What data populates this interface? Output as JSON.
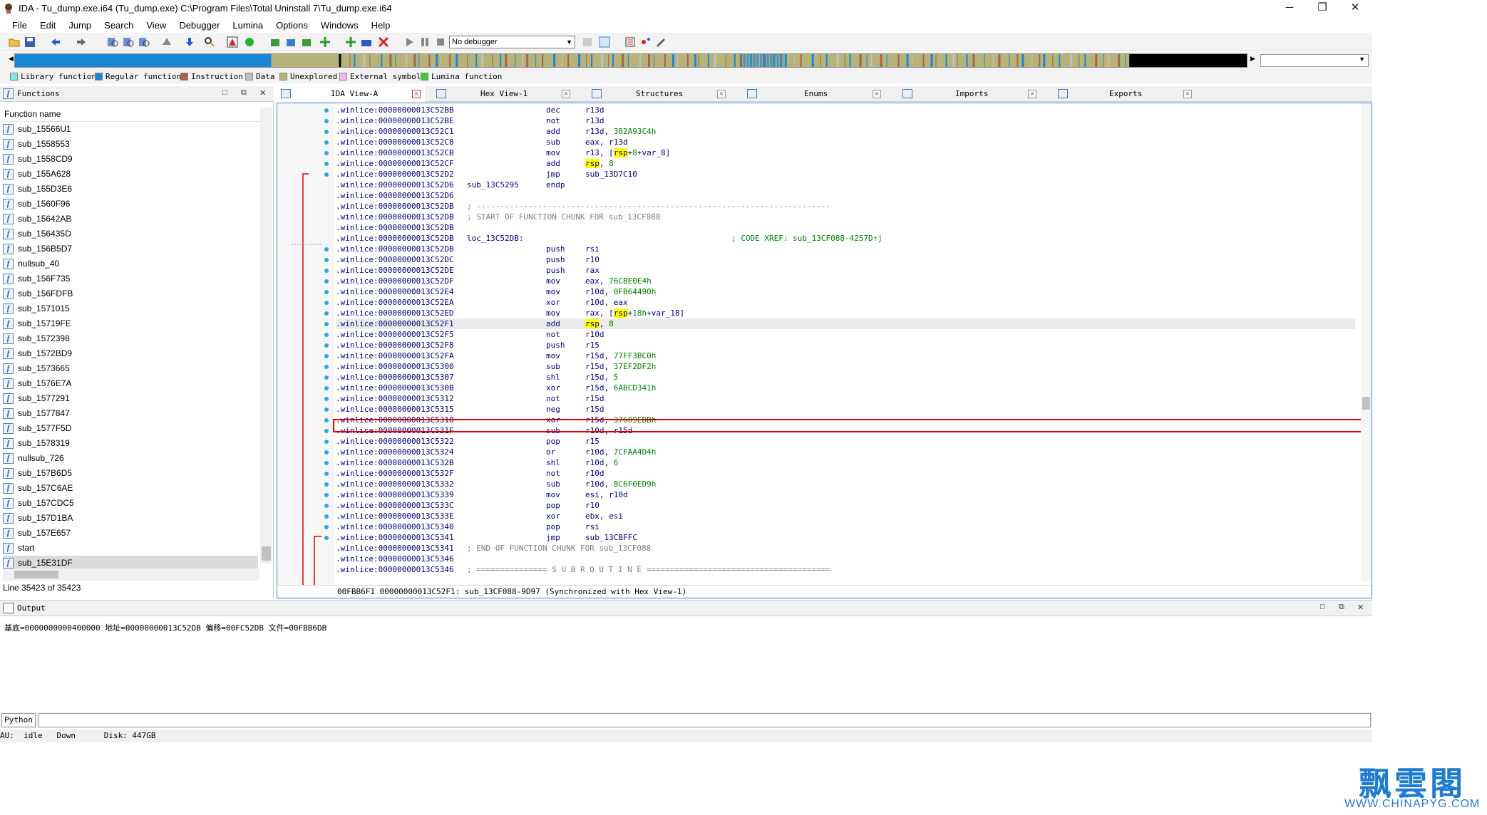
{
  "window": {
    "title": "IDA - Tu_dump.exe.i64 (Tu_dump.exe) C:\\Program Files\\Total Uninstall 7\\Tu_dump.exe.i64",
    "controls": {
      "minimize": "─",
      "restore": "❐",
      "close": "✕"
    }
  },
  "menu": [
    "File",
    "Edit",
    "Jump",
    "Search",
    "View",
    "Debugger",
    "Lumina",
    "Options",
    "Windows",
    "Help"
  ],
  "toolbar": {
    "debugger_select": "No debugger"
  },
  "legend": [
    {
      "label": "Library function",
      "color": "#7fe9ea"
    },
    {
      "label": "Regular function",
      "color": "#1a86d8"
    },
    {
      "label": "Instruction",
      "color": "#a7644b"
    },
    {
      "label": "Data",
      "color": "#c0c0c0"
    },
    {
      "label": "Unexplored",
      "color": "#b7b378"
    },
    {
      "label": "External symbol",
      "color": "#f7b6e6"
    },
    {
      "label": "Lumina function",
      "color": "#3ec93e"
    }
  ],
  "functions_panel": {
    "title": "Functions",
    "column_header": "Function name",
    "items": [
      "sub_15566U1",
      "sub_1558553",
      "sub_1558CD9",
      "sub_155A628",
      "sub_155D3E6",
      "sub_1560F96",
      "sub_15642AB",
      "sub_156435D",
      "sub_156B5D7",
      "nullsub_40",
      "sub_156F735",
      "sub_156FDFB",
      "sub_1571015",
      "sub_15719FE",
      "sub_1572398",
      "sub_1572BD9",
      "sub_1573665",
      "sub_1576E7A",
      "sub_1577291",
      "sub_1577847",
      "sub_1577F5D",
      "sub_1578319",
      "nullsub_726",
      "sub_157B6D5",
      "sub_157C6AE",
      "sub_157CDC5",
      "sub_157D1BA",
      "sub_157E657",
      "start",
      "sub_15E31DF"
    ],
    "selected_index": 29,
    "status": "Line 35423 of 35423"
  },
  "tabs": [
    {
      "label": "IDA View-A",
      "active": true
    },
    {
      "label": "Hex View-1",
      "active": false
    },
    {
      "label": "Structures",
      "active": false
    },
    {
      "label": "Enums",
      "active": false
    },
    {
      "label": "Imports",
      "active": false
    },
    {
      "label": "Exports",
      "active": false
    }
  ],
  "disasm": [
    {
      "addr": ".winlice:00000000013C52BB",
      "mn": "dec",
      "op": "r13d"
    },
    {
      "addr": ".winlice:00000000013C52BE",
      "mn": "not",
      "op": "r13d"
    },
    {
      "addr": ".winlice:00000000013C52C1",
      "mn": "add",
      "op": "r13d, 382A93C4h"
    },
    {
      "addr": ".winlice:00000000013C52C8",
      "mn": "sub",
      "op": "eax, r13d"
    },
    {
      "addr": ".winlice:00000000013C52CB",
      "mn": "mov",
      "op": "r13, [rsp+8+var_8]"
    },
    {
      "addr": ".winlice:00000000013C52CF",
      "mn": "add",
      "op": "rsp, 8"
    },
    {
      "addr": ".winlice:00000000013C52D2",
      "mn": "jmp",
      "op": "sub_13D7C10"
    },
    {
      "addr": ".winlice:00000000013C52D6",
      "raw": "sub_13C5295",
      "mn": "endp",
      "op": ""
    },
    {
      "addr": ".winlice:00000000013C52D6",
      "mn": "",
      "op": ""
    },
    {
      "addr": ".winlice:00000000013C52DB",
      "raw": "; ---------------------------------------------------------------------------",
      "mn": "",
      "op": ""
    },
    {
      "addr": ".winlice:00000000013C52DB",
      "raw": "; START OF FUNCTION CHUNK FOR sub_13CF088",
      "mn": "",
      "op": ""
    },
    {
      "addr": ".winlice:00000000013C52DB",
      "mn": "",
      "op": ""
    },
    {
      "addr": ".winlice:00000000013C52DB",
      "raw": "loc_13C52DB:",
      "xref": "; CODE XREF: sub_13CF088-4257D↑j",
      "mn": "",
      "op": ""
    },
    {
      "addr": ".winlice:00000000013C52DB",
      "mn": "push",
      "op": "rsi"
    },
    {
      "addr": ".winlice:00000000013C52DC",
      "mn": "push",
      "op": "r10"
    },
    {
      "addr": ".winlice:00000000013C52DE",
      "mn": "push",
      "op": "rax"
    },
    {
      "addr": ".winlice:00000000013C52DF",
      "mn": "mov",
      "op": "eax, 76CBE0E4h"
    },
    {
      "addr": ".winlice:00000000013C52E4",
      "mn": "mov",
      "op": "r10d, 0FB64490h"
    },
    {
      "addr": ".winlice:00000000013C52EA",
      "mn": "xor",
      "op": "r10d, eax"
    },
    {
      "addr": ".winlice:00000000013C52ED",
      "mn": "mov",
      "op": "rax, [rsp+18h+var_18]"
    },
    {
      "addr": ".winlice:00000000013C52F1",
      "mn": "add",
      "op": "rsp, 8"
    },
    {
      "addr": ".winlice:00000000013C52F5",
      "mn": "not",
      "op": "r10d"
    },
    {
      "addr": ".winlice:00000000013C52F8",
      "mn": "push",
      "op": "r15"
    },
    {
      "addr": ".winlice:00000000013C52FA",
      "mn": "mov",
      "op": "r15d, 77FF3BC0h"
    },
    {
      "addr": ".winlice:00000000013C5300",
      "mn": "sub",
      "op": "r15d, 37EF2DF2h"
    },
    {
      "addr": ".winlice:00000000013C5307",
      "mn": "shl",
      "op": "r15d, 5"
    },
    {
      "addr": ".winlice:00000000013C530B",
      "mn": "xor",
      "op": "r15d, 6ABCD341h"
    },
    {
      "addr": ".winlice:00000000013C5312",
      "mn": "not",
      "op": "r15d"
    },
    {
      "addr": ".winlice:00000000013C5315",
      "mn": "neg",
      "op": "r15d"
    },
    {
      "addr": ".winlice:00000000013C5318",
      "mn": "xor",
      "op": "r15d, 37609EDBh"
    },
    {
      "addr": ".winlice:00000000013C531F",
      "mn": "sub",
      "op": "r10d, r15d"
    },
    {
      "addr": ".winlice:00000000013C5322",
      "mn": "pop",
      "op": "r15"
    },
    {
      "addr": ".winlice:00000000013C5324",
      "mn": "or",
      "op": "r10d, 7CFAA4D4h"
    },
    {
      "addr": ".winlice:00000000013C532B",
      "mn": "shl",
      "op": "r10d, 6"
    },
    {
      "addr": ".winlice:00000000013C532F",
      "mn": "not",
      "op": "r10d"
    },
    {
      "addr": ".winlice:00000000013C5332",
      "mn": "sub",
      "op": "r10d, 8C6F0ED9h"
    },
    {
      "addr": ".winlice:00000000013C5339",
      "mn": "mov",
      "op": "esi, r10d"
    },
    {
      "addr": ".winlice:00000000013C533C",
      "mn": "pop",
      "op": "r10"
    },
    {
      "addr": ".winlice:00000000013C533E",
      "mn": "xor",
      "op": "ebx, esi"
    },
    {
      "addr": ".winlice:00000000013C5340",
      "mn": "pop",
      "op": "rsi"
    },
    {
      "addr": ".winlice:00000000013C5341",
      "mn": "jmp",
      "op": "sub_13CBFFC"
    },
    {
      "addr": ".winlice:00000000013C5341",
      "raw": "; END OF FUNCTION CHUNK FOR sub_13CF088",
      "mn": "",
      "op": ""
    },
    {
      "addr": ".winlice:00000000013C5346",
      "mn": "",
      "op": ""
    },
    {
      "addr": ".winlice:00000000013C5346",
      "raw": "; =============== S U B R O U T I N E =======================================",
      "mn": "",
      "op": ""
    }
  ],
  "current_line_index": 20,
  "ida_status": "00FBB6F1 00000000013C52F1: sub_13CF088-9D97 (Synchronized with Hex View-1)",
  "output": {
    "title": "Output",
    "text": "基底=0000000000400000 地址=00000000013C52DB 偏移=00FC52DB 文件=00FBB6DB"
  },
  "python_button": "Python",
  "statusbar": "AU:  idle   Down      Disk: 447GB",
  "watermark": {
    "cn": "飘雲閣",
    "url": "WWW.CHINAPYG.COM"
  }
}
